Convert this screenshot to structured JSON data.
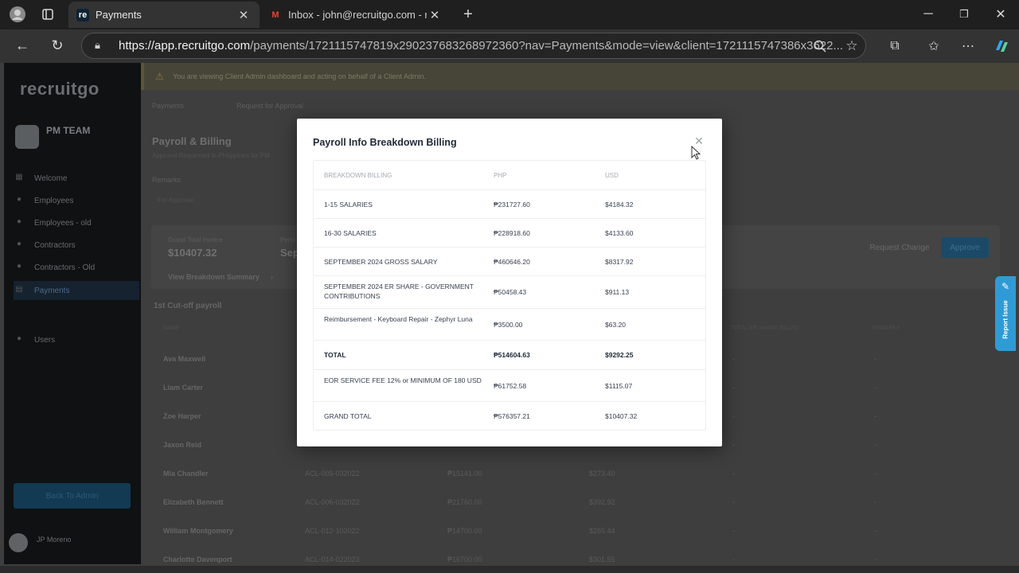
{
  "browser": {
    "tabs": [
      {
        "title": "Payments",
        "active": true,
        "favicon": "re"
      },
      {
        "title": "Inbox - john@recruitgo.com - rec",
        "active": false,
        "favicon": "M"
      }
    ],
    "url_host": "https://app.recruitgo.com",
    "url_rest": "/payments/1721115747819x290237683268972360?nav=Payments&mode=view&client=1721115747386x3622..."
  },
  "sidebar": {
    "logo": "recruitgo",
    "team_name": "PM TEAM",
    "nav": [
      {
        "label": "Welcome",
        "icon": "grid-icon"
      },
      {
        "label": "Employees",
        "icon": "person-icon"
      },
      {
        "label": "Employees - old",
        "icon": "person-icon"
      },
      {
        "label": "Contractors",
        "icon": "person-icon"
      },
      {
        "label": "Contractors - Old",
        "icon": "person-icon"
      },
      {
        "label": "Payments",
        "icon": "payments-icon",
        "active": true
      },
      {
        "label": "Users",
        "icon": "person-icon"
      }
    ],
    "back_button": "Back To Admin",
    "user_name": "JP Moreno"
  },
  "banner": "You are viewing Client Admin dashboard and acting on behalf of a Client Admin.",
  "background": {
    "tabs": [
      "Payments",
      "Request for Approval"
    ],
    "page_title": "Payroll & Billing",
    "subtitle": "Approval Requested in Philippines for PM",
    "remarks_label": "Remarks",
    "remarks_value": "For Approval",
    "grand_total_label": "Grand Total Invoice",
    "grand_total_value": "$10407.32",
    "period_label": "Perio",
    "period_value": "Sep",
    "view_breakdown": "View Breakdown Summary",
    "request_change": "Request Change",
    "approve": "Approve",
    "section_title": "1st Cut-off payroll",
    "col_name": "NAME",
    "col_er_share": "TOTAL ER SHARE BILLED",
    "col_remarks": "REMARKS",
    "rows": [
      {
        "name": "Ava Maxwell",
        "id": "",
        "php": "",
        "usd": "",
        "er": "-",
        "remarks": "-"
      },
      {
        "name": "Liam Carter",
        "id": "",
        "php": "",
        "usd": "",
        "er": "-",
        "remarks": "-"
      },
      {
        "name": "Zoe Harper",
        "id": "",
        "php": "",
        "usd": "",
        "er": "-",
        "remarks": "-"
      },
      {
        "name": "Jaxon Reid",
        "id": "",
        "php": "",
        "usd": "",
        "er": "-",
        "remarks": "-"
      },
      {
        "name": "Mia Chandler",
        "id": "ACL-005-032022",
        "php": "₱15141.00",
        "usd": "$273.40",
        "er": "-",
        "remarks": "-"
      },
      {
        "name": "Elizabeth Bennett",
        "id": "ACL-006-032022",
        "php": "₱21760.00",
        "usd": "$392.92",
        "er": "-",
        "remarks": "-"
      },
      {
        "name": "William Montgomery",
        "id": "ACL-012-102022",
        "php": "₱14700.00",
        "usd": "$265.44",
        "er": "-",
        "remarks": "-"
      },
      {
        "name": "Charlotte Davenport",
        "id": "ACL-014-022023",
        "php": "₱16700.00",
        "usd": "$301.55",
        "er": "-",
        "remarks": "-"
      }
    ]
  },
  "report_issue": "Report Issue",
  "modal": {
    "title": "Payroll Info Breakdown Billing",
    "headers": [
      "BREAKDOWN BILLING",
      "PHP",
      "USD"
    ],
    "rows": [
      {
        "label": "1-15 SALARIES",
        "php": "₱231727.60",
        "usd": "$4184.32",
        "bold": false
      },
      {
        "label": "16-30 SALARIES",
        "php": "₱228918.60",
        "usd": "$4133.60",
        "bold": false
      },
      {
        "label": "SEPTEMBER 2024 GROSS SALARY",
        "php": "₱460646.20",
        "usd": "$8317.92",
        "bold": false
      },
      {
        "label": "SEPTEMBER 2024 ER SHARE - GOVERNMENT CONTRIBUTIONS",
        "php": "₱50458.43",
        "usd": "$911.13",
        "bold": false
      },
      {
        "label": "Reimbursement - Keyboard Repair -   Zephyr Luna",
        "php": "₱3500.00",
        "usd": "$63.20",
        "bold": false
      },
      {
        "label": "TOTAL",
        "php": "₱514604.63",
        "usd": "$9292.25",
        "bold": true
      },
      {
        "label": "EOR SERVICE FEE 12% or MINIMUM OF 180 USD",
        "php": "₱61752.58",
        "usd": "$1115.07",
        "bold": false
      },
      {
        "label": "GRAND TOTAL",
        "php": "₱576357.21",
        "usd": "$10407.32",
        "bold": false
      }
    ]
  }
}
